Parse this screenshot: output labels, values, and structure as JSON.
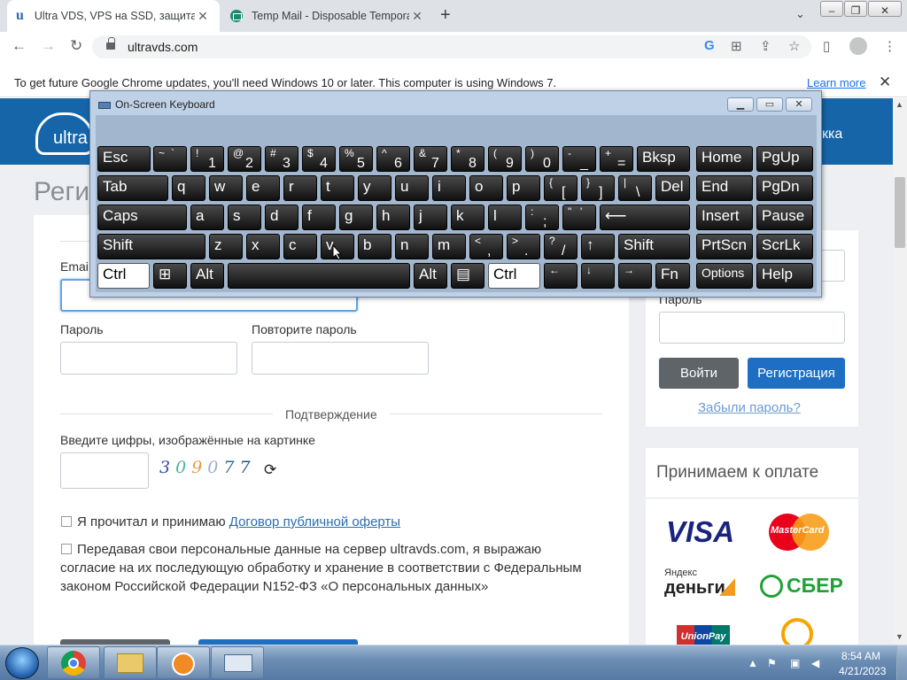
{
  "browser": {
    "tabs": [
      {
        "title": "Ultra VDS, VPS на SSD, защита с",
        "favicon": "u",
        "close": "✕",
        "active": true
      },
      {
        "title": "Temp Mail - Disposable Tempora",
        "close": "✕",
        "active": false
      }
    ],
    "new_tab": "+",
    "url": "ultravds.com",
    "infobar": {
      "text": "To get future Google Chrome updates, you'll need Windows 10 or later. This computer is using Windows 7.",
      "link": "Learn more",
      "close": "✕"
    }
  },
  "site": {
    "logo_text": "ultra",
    "header_right": "кка",
    "page_title": "Реги",
    "register": {
      "email_label": "Emai",
      "password_label": "Пароль",
      "repeat_password_label": "Повторите пароль",
      "confirm_heading": "Подтверждение",
      "captcha_label": "Введите цифры, изображённые на картинке",
      "captcha_digits": [
        "3",
        "0",
        "9",
        "0",
        "7",
        "7"
      ],
      "agree_text": "Я прочитал и принимаю",
      "agree_link": "Договор публичной оферты",
      "consent_text": "Передавая свои персональные данные на сервер ultravds.com, я выражаю согласие на их последующую обработку и хранение в соответствии с Федеральным законом Российской Федерации N152-ФЗ «О персональных данных»"
    },
    "login": {
      "password_label": "Пароль",
      "login_button": "Войти",
      "register_button": "Регистрация",
      "forgot_link": "Забыли пароль?"
    },
    "payments": {
      "title": "Принимаем к оплате",
      "visa": "VISA",
      "mastercard": "MasterCard",
      "yandex_small": "Яндекс",
      "yandex_big": "деньги",
      "sber": "СБЕР",
      "unionpay": "UnionPay"
    }
  },
  "osk": {
    "title": "On-Screen Keyboard",
    "keys": {
      "esc": "Esc",
      "tab": "Tab",
      "caps": "Caps",
      "shift": "Shift",
      "ctrl": "Ctrl",
      "alt": "Alt",
      "bksp": "Bksp",
      "del": "Del",
      "home": "Home",
      "pgup": "PgUp",
      "end": "End",
      "pgdn": "PgDn",
      "insert": "Insert",
      "pause": "Pause",
      "prtscn": "PrtScn",
      "scrlk": "ScrLk",
      "options": "Options",
      "help": "Help",
      "fn": "Fn",
      "row1": [
        [
          "~",
          "`"
        ],
        [
          "!",
          "1"
        ],
        [
          "@",
          "2"
        ],
        [
          "#",
          "3"
        ],
        [
          "$",
          "4"
        ],
        [
          "%",
          "5"
        ],
        [
          "^",
          "6"
        ],
        [
          "&",
          "7"
        ],
        [
          "*",
          "8"
        ],
        [
          "(",
          "9"
        ],
        [
          ")",
          "0"
        ],
        [
          "-",
          "_"
        ],
        [
          "+",
          "="
        ]
      ],
      "row2": [
        "q",
        "w",
        "e",
        "r",
        "t",
        "y",
        "u",
        "i",
        "o",
        "p",
        [
          "{",
          "["
        ],
        [
          "}",
          "]"
        ],
        [
          "|",
          "\\"
        ]
      ],
      "row3": [
        "a",
        "s",
        "d",
        "f",
        "g",
        "h",
        "j",
        "k",
        "l",
        [
          ":",
          ";"
        ],
        [
          "\"",
          "'"
        ]
      ],
      "row4": [
        "z",
        "x",
        "c",
        "v",
        "b",
        "n",
        "m",
        [
          "<",
          ","
        ],
        [
          ">",
          "."
        ],
        [
          "?",
          "/"
        ]
      ],
      "arrows": {
        "up": "↑",
        "left": "←",
        "down": "↓",
        "right": "→",
        "enter": "⟵"
      }
    }
  },
  "taskbar": {
    "time": "8:54 AM",
    "date": "4/21/2023"
  }
}
